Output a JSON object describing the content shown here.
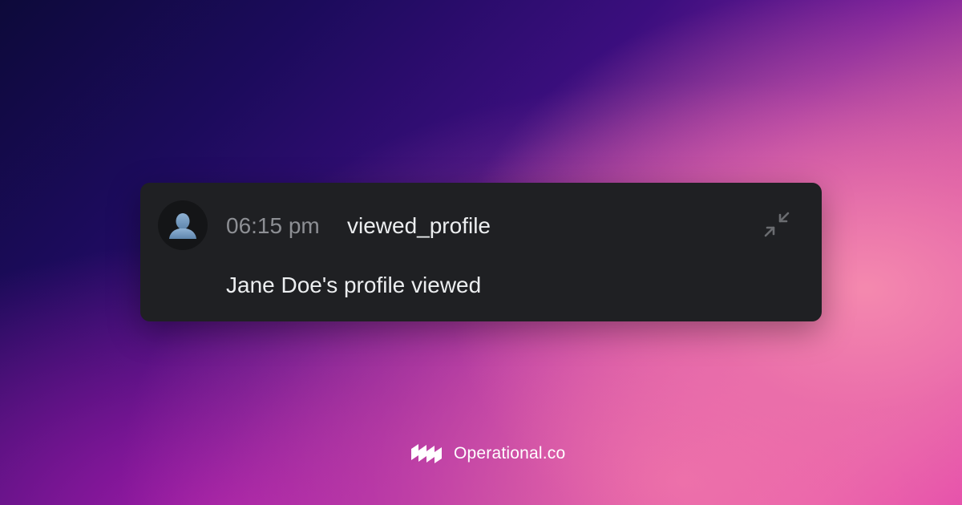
{
  "notification": {
    "time": "06:15 pm",
    "event_name": "viewed_profile",
    "message": "Jane Doe's profile viewed",
    "avatar_icon": "user-silhouette-icon",
    "collapse_icon": "collapse-arrows-icon"
  },
  "brand": {
    "name": "Operational.co",
    "logo_icon": "operational-logo-icon"
  },
  "colors": {
    "card_background": "#1f2023",
    "time_text": "#8d8f94",
    "primary_text": "#eceef0",
    "icon_muted": "#6a6c70",
    "avatar_silhouette": "#7a9ec2"
  }
}
